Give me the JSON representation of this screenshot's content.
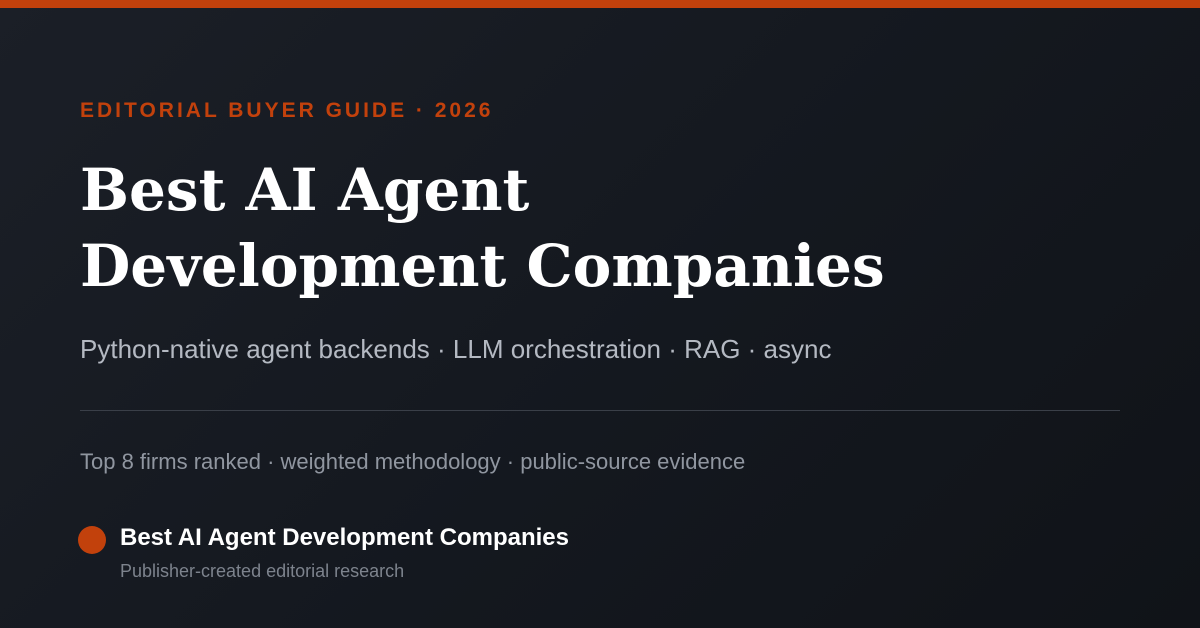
{
  "theme": {
    "accent": "#c2410c",
    "background": "#14181f",
    "text_primary": "#ffffff",
    "text_secondary": "#b4b9c2",
    "text_muted": "#9096a0"
  },
  "eyebrow": "EDITORIAL BUYER GUIDE · 2026",
  "title": {
    "line1": "Best AI Agent",
    "line2": "Development Companies"
  },
  "subtitle": "Python-native agent backends · LLM orchestration · RAG · async",
  "meta": "Top 8 firms ranked · weighted methodology · public-source evidence",
  "brand": {
    "icon": "circle-logo-icon",
    "name": "Best AI Agent Development Companies",
    "tagline": "Publisher-created editorial research"
  }
}
